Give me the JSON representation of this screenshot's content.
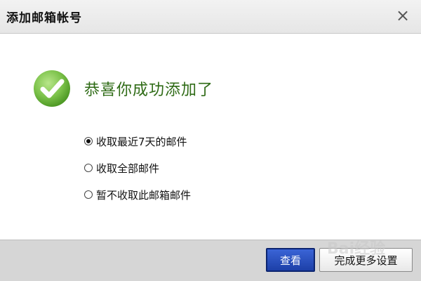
{
  "dialog": {
    "title": "添加邮箱帐号",
    "close_glyph": "×"
  },
  "content": {
    "headline": "恭喜你成功添加了",
    "options": [
      {
        "label": "收取最近7天的邮件",
        "checked": true
      },
      {
        "label": "收取全部邮件",
        "checked": false
      },
      {
        "label": "暂不收取此邮箱邮件",
        "checked": false
      }
    ]
  },
  "footer": {
    "view_label": "查看",
    "more_settings_label": "完成更多设置"
  },
  "watermark": {
    "text": "Bai经验"
  },
  "colors": {
    "headline": "#2f6b16",
    "check_green": "#7cc24a",
    "primary_button": "#1d40a8",
    "footer_bg": "#d6d6d6"
  },
  "icons": {
    "success": "checkmark-circle-icon",
    "close": "close-icon"
  }
}
